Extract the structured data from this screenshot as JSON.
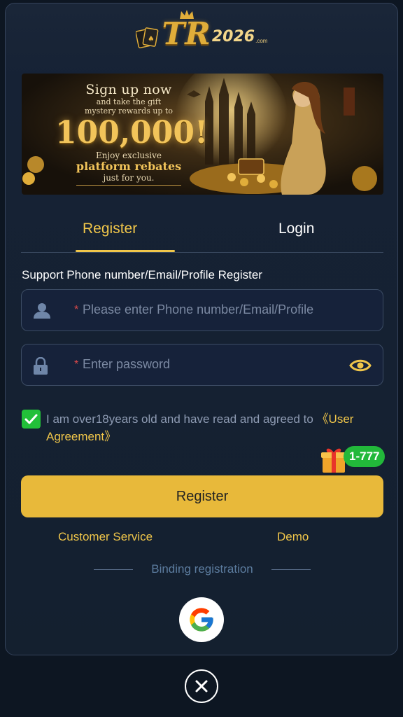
{
  "brand": {
    "logo_text": "TR",
    "logo_year": "2026",
    "logo_domain": ".com"
  },
  "banner": {
    "title": "Sign up now",
    "line1": "and take the gift",
    "line2": "mystery rewards up to",
    "amount": "100,000!",
    "line3": "Enjoy exclusive",
    "line4": "platform rebates",
    "line5": "just for you."
  },
  "tabs": {
    "register": "Register",
    "login": "Login",
    "active": "register"
  },
  "form": {
    "support_text": "Support Phone number/Email/Profile Register",
    "account_placeholder": "Please enter Phone number/Email/Profile",
    "password_placeholder": "Enter password",
    "required_mark": "*",
    "agree_text": "I am over18years old and have read and agreed to ",
    "agree_link": "《User Agreement》",
    "agree_checked": true,
    "register_button": "Register"
  },
  "promo": {
    "badge": "1-777"
  },
  "links": {
    "customer_service": "Customer Service",
    "demo": "Demo"
  },
  "binding": {
    "label": "Binding registration",
    "providers": [
      "google-icon"
    ]
  },
  "colors": {
    "accent": "#f0c64a",
    "button": "#e8b93a",
    "check": "#22c039",
    "background": "#0d1622",
    "panel": "#162235"
  },
  "icons": [
    "user-icon",
    "lock-icon",
    "eye-icon",
    "check-icon",
    "gift-icon",
    "google-icon",
    "close-icon",
    "crown-icon",
    "cards-icon"
  ]
}
